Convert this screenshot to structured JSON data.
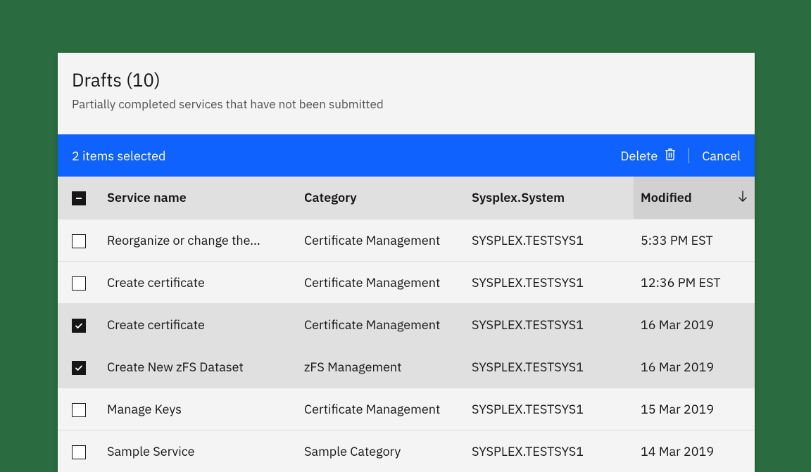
{
  "header": {
    "title": "Drafts (10)",
    "subtitle": "Partially completed services that have not been submitted"
  },
  "actionBar": {
    "selectedText": "2 items selected",
    "deleteLabel": "Delete",
    "cancelLabel": "Cancel"
  },
  "table": {
    "columns": {
      "name": "Service name",
      "category": "Category",
      "system": "Sysplex.System",
      "modified": "Modified"
    },
    "rows": [
      {
        "selected": false,
        "name": "Reorganize or change the...",
        "category": "Certificate Management",
        "system": "SYSPLEX.TESTSYS1",
        "modified": "5:33 PM EST"
      },
      {
        "selected": false,
        "name": "Create certificate",
        "category": "Certificate Management",
        "system": "SYSPLEX.TESTSYS1",
        "modified": "12:36 PM EST"
      },
      {
        "selected": true,
        "name": "Create certificate",
        "category": "Certificate Management",
        "system": "SYSPLEX.TESTSYS1",
        "modified": "16 Mar 2019"
      },
      {
        "selected": true,
        "name": "Create New zFS Dataset",
        "category": "zFS Management",
        "system": "SYSPLEX.TESTSYS1",
        "modified": "16 Mar 2019"
      },
      {
        "selected": false,
        "name": "Manage Keys",
        "category": "Certificate Management",
        "system": "SYSPLEX.TESTSYS1",
        "modified": "15 Mar 2019"
      },
      {
        "selected": false,
        "name": "Sample Service",
        "category": "Sample Category",
        "system": "SYSPLEX.TESTSYS1",
        "modified": "14 Mar 2019"
      }
    ]
  }
}
